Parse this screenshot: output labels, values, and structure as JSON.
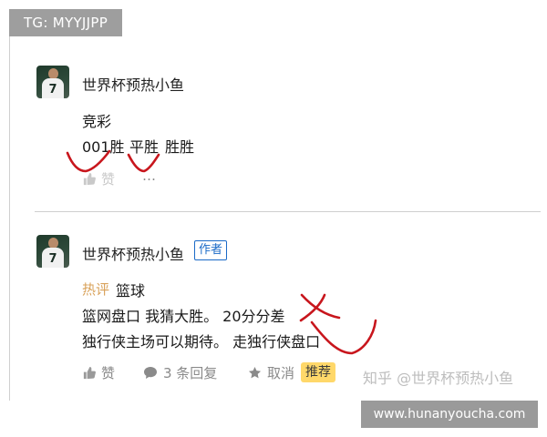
{
  "watermark_top": "TG: MYYJJPP",
  "watermark_bottom": "www.hunanyoucha.com",
  "comments": [
    {
      "author": "世界杯预热小鱼",
      "line1": "竞彩",
      "line2_parts": [
        "001胜",
        "平胜",
        "胜胜"
      ],
      "like_label": "赞",
      "more_label": "…"
    },
    {
      "author": "世界杯预热小鱼",
      "author_tag": "作者",
      "hot_label": "热评",
      "topic": "篮球",
      "line1": "篮网盘口 我猜大胜。 20分分差",
      "line2": "独行侠主场可以期待。 走独行侠盘口",
      "like_label": "赞",
      "reply_label": "3 条回复",
      "cancel_label": "取消",
      "recommend_label": "推荐",
      "zhihu_watermark": "知乎 @世界杯预热小鱼"
    }
  ],
  "colors": {
    "accent_blue": "#1a6ac7",
    "hot_orange": "#d9a25a",
    "recommend_yellow": "#ffd86a",
    "scribble_red": "#c8161d"
  }
}
